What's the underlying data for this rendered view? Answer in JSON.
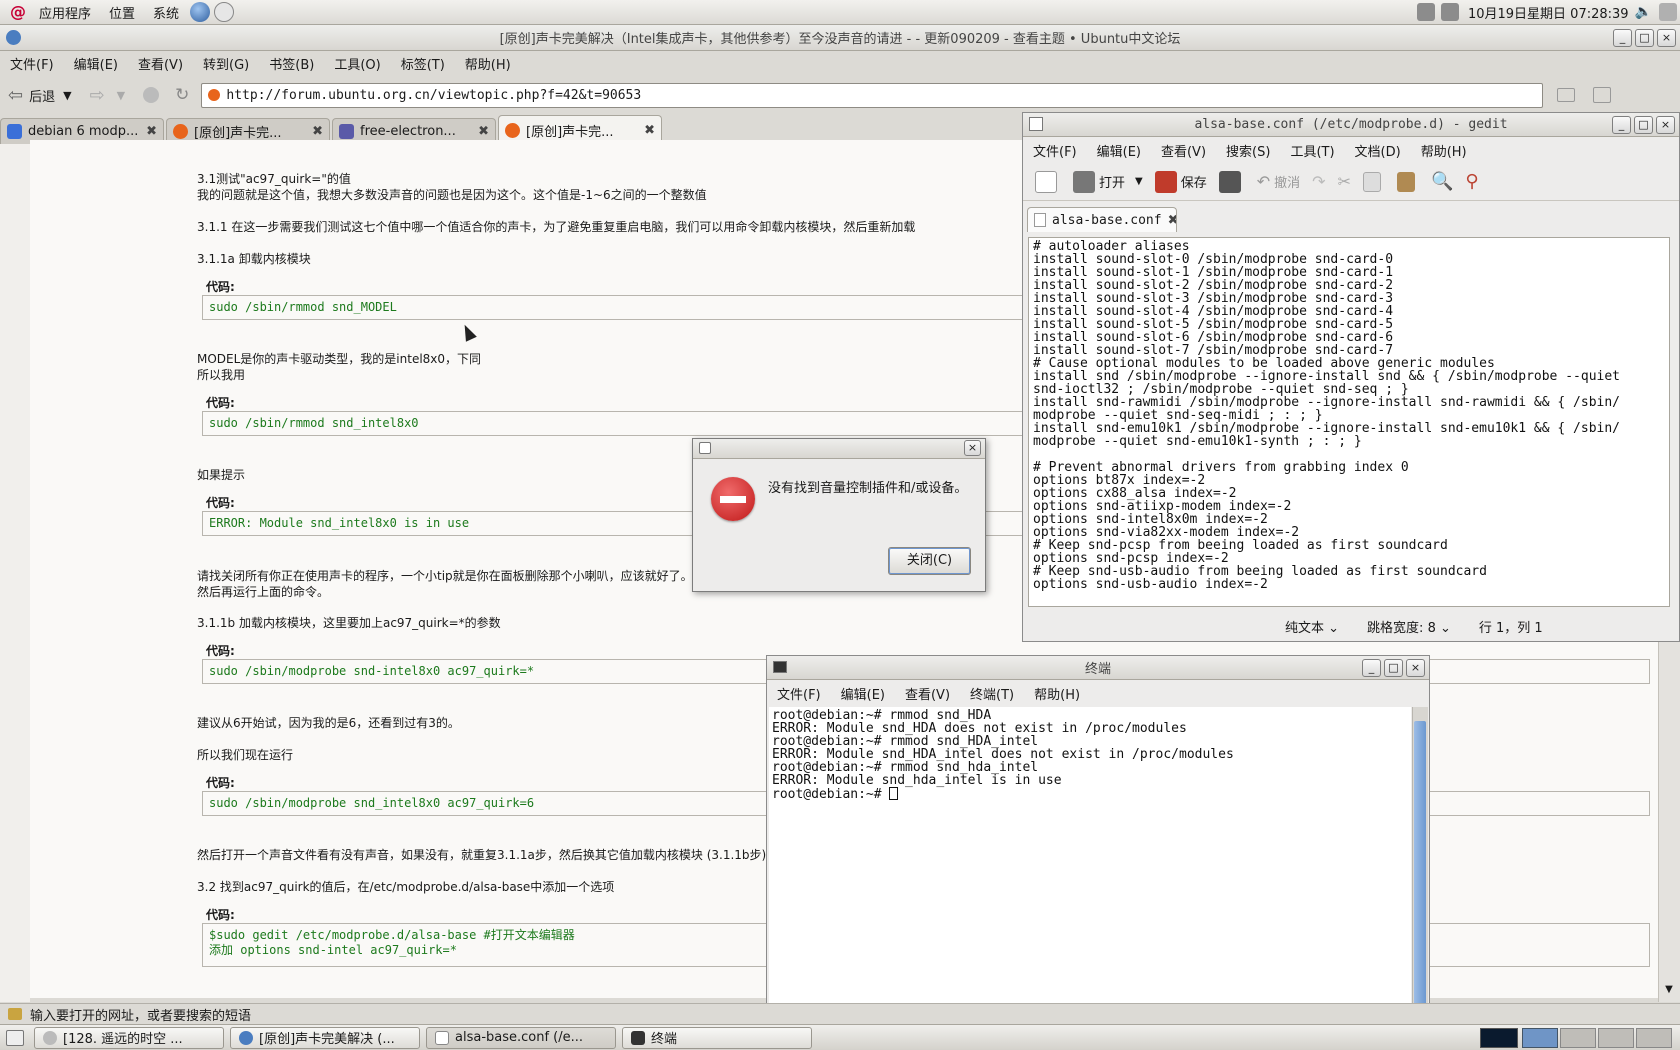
{
  "top_panel": {
    "menus": [
      "应用程序",
      "位置",
      "系统"
    ],
    "clock": "10月19日星期日 07:28:39"
  },
  "browser": {
    "title": "[原创]声卡完美解决（Intel集成声卡，其他供参考）至今没声音的请进 - - 更新090209 - 查看主题 • Ubuntu中文论坛",
    "menu": [
      "文件(F)",
      "编辑(E)",
      "查看(V)",
      "转到(G)",
      "书签(B)",
      "工具(O)",
      "标签(T)",
      "帮助(H)"
    ],
    "back_label": "后退",
    "url": "http://forum.ubuntu.org.cn/viewtopic.php?f=42&t=90653",
    "tabs": [
      {
        "label": "debian 6 modp...",
        "color": "#3a6fd8"
      },
      {
        "label": "[原创]声卡完...",
        "color": "#e8641b"
      },
      {
        "label": "free-electron...",
        "color": "#5a5aa8"
      },
      {
        "label": "[原创]声卡完...",
        "color": "#e8641b"
      }
    ],
    "status_text": "输入要打开的网址，或者要搜索的短语"
  },
  "article": {
    "code_label": "代码:",
    "p1": "3.1测试\"ac97_quirk=\"的值",
    "p2": "我的问题就是这个值，我想大多数没声音的问题也是因为这个。这个值是-1~6之间的一个整数值",
    "p3": "3.1.1 在这一步需要我们测试这七个值中哪一个值适合你的声卡，为了避免重复重启电脑，我们可以用命令卸载内核模块，然后重新加载",
    "p4": "3.1.1a 卸载内核模块",
    "code1": "sudo /sbin/rmmod snd_MODEL",
    "p5": "MODEL是你的声卡驱动类型，我的是intel8x0，下同",
    "p6": "所以我用",
    "code2": "sudo /sbin/rmmod snd_intel8x0",
    "p7": "如果提示",
    "code3": "ERROR: Module snd_intel8x0 is in use",
    "p8": "请找关闭所有你正在使用声卡的程序，一个小tip就是你在面板删除那个小喇叭，应该就好了。",
    "p9": "然后再运行上面的命令。",
    "p10": "3.1.1b 加载内核模块，这里要加上ac97_quirk=*的参数",
    "code4": "sudo /sbin/modprobe snd-intel8x0 ac97_quirk=*",
    "p11": "建议从6开始试，因为我的是6，还看到过有3的。",
    "p12": "所以我们现在运行",
    "code5": "sudo /sbin/modprobe snd_intel8x0 ac97_quirk=6",
    "p13": "然后打开一个声音文件看有没有声音，如果没有，就重复3.1.1a步，然后换其它值加载内核模块 (3.1.1b步)",
    "p14": "3.2 找到ac97_quirk的值后，在/etc/modprobe.d/alsa-base中添加一个选项",
    "code6": "$sudo gedit /etc/modprobe.d/alsa-base #打开文本编辑器\n添加 options snd-intel ac97_quirk=*"
  },
  "gedit": {
    "title": "alsa-base.conf (/etc/modprobe.d) - gedit",
    "menu": [
      "文件(F)",
      "编辑(E)",
      "查看(V)",
      "搜索(S)",
      "工具(T)",
      "文档(D)",
      "帮助(H)"
    ],
    "open_label": "打开",
    "save_label": "保存",
    "undo_label": "撤消",
    "tab_label": "alsa-base.conf",
    "text": "# autoloader aliases\ninstall sound-slot-0 /sbin/modprobe snd-card-0\ninstall sound-slot-1 /sbin/modprobe snd-card-1\ninstall sound-slot-2 /sbin/modprobe snd-card-2\ninstall sound-slot-3 /sbin/modprobe snd-card-3\ninstall sound-slot-4 /sbin/modprobe snd-card-4\ninstall sound-slot-5 /sbin/modprobe snd-card-5\ninstall sound-slot-6 /sbin/modprobe snd-card-6\ninstall sound-slot-7 /sbin/modprobe snd-card-7\n# Cause optional modules to be loaded above generic modules\ninstall snd /sbin/modprobe --ignore-install snd && { /sbin/modprobe --quiet\nsnd-ioctl32 ; /sbin/modprobe --quiet snd-seq ; }\ninstall snd-rawmidi /sbin/modprobe --ignore-install snd-rawmidi && { /sbin/\nmodprobe --quiet snd-seq-midi ; : ; }\ninstall snd-emu10k1 /sbin/modprobe --ignore-install snd-emu10k1 && { /sbin/\nmodprobe --quiet snd-emu10k1-synth ; : ; }\n\n# Prevent abnormal drivers from grabbing index 0\noptions bt87x index=-2\noptions cx88_alsa index=-2\noptions snd-atiixp-modem index=-2\noptions snd-intel8x0m index=-2\noptions snd-via82xx-modem index=-2\n# Keep snd-pcsp from beeing loaded as first soundcard\noptions snd-pcsp index=-2\n# Keep snd-usb-audio from beeing loaded as first soundcard\noptions snd-usb-audio index=-2",
    "status_mode": "纯文本",
    "status_tab_label": "跳格宽度:",
    "status_tab_value": "8",
    "status_pos": "行 1，列 1"
  },
  "terminal": {
    "title": "终端",
    "menu": [
      "文件(F)",
      "编辑(E)",
      "查看(V)",
      "终端(T)",
      "帮助(H)"
    ],
    "text": "root@debian:~# rmmod snd_HDA\nERROR: Module snd_HDA does not exist in /proc/modules\nroot@debian:~# rmmod snd_HDA_intel\nERROR: Module snd_HDA_intel does not exist in /proc/modules\nroot@debian:~# rmmod snd_hda_intel\nERROR: Module snd_hda_intel is in use\nroot@debian:~# "
  },
  "dialog": {
    "message": "没有找到音量控制插件和/或设备。",
    "close_label": "关闭(C)"
  },
  "taskbar": {
    "items": [
      "[128. 遥远的时空 ...",
      "[原创]声卡完美解决 (...",
      "alsa-base.conf (/e...",
      "终端"
    ]
  }
}
